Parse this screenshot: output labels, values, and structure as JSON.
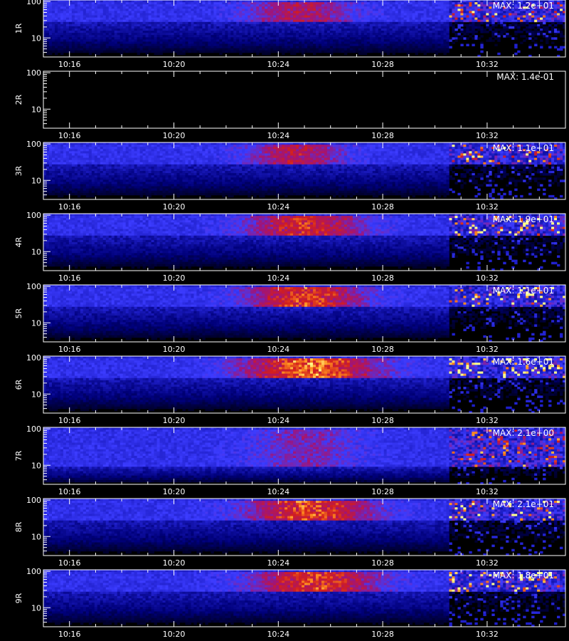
{
  "chart_data": {
    "type": "heatmap",
    "xlabel": "",
    "x_ticks": [
      "10:16",
      "10:20",
      "10:24",
      "10:28",
      "10:32"
    ],
    "x_range_min": [
      15,
      35
    ],
    "y_scale": "log",
    "y_ticks": [
      "100",
      "10"
    ],
    "y_range": [
      3,
      110
    ],
    "colors": {
      "background": "#000000",
      "low": "#00007a",
      "mid": "#3c3cff",
      "high_red": "#d21e1e",
      "high_orange": "#ff8c1e",
      "peak": "#ffff8c",
      "axes": "#ffffff"
    },
    "panels": [
      {
        "label": "1R",
        "max": "MAX: 1.2e+01",
        "level": 0.55,
        "burst_center_min": 24.8,
        "burst_width_min": 2.0,
        "band_top": 90,
        "band_bottom": 28,
        "empty": false
      },
      {
        "label": "2R",
        "max": "MAX: 1.4e-01",
        "level": 0.0,
        "burst_center_min": 24.8,
        "burst_width_min": 2.0,
        "band_top": 90,
        "band_bottom": 28,
        "empty": true
      },
      {
        "label": "3R",
        "max": "MAX: 1.1e+01",
        "level": 0.6,
        "burst_center_min": 24.6,
        "burst_width_min": 1.8,
        "band_top": 90,
        "band_bottom": 28,
        "empty": false
      },
      {
        "label": "4R",
        "max": "MAX: 1.9e+01",
        "level": 0.75,
        "burst_center_min": 25.0,
        "burst_width_min": 2.2,
        "band_top": 90,
        "band_bottom": 28,
        "empty": false
      },
      {
        "label": "5R",
        "max": "MAX: 1.1e+01",
        "level": 0.8,
        "burst_center_min": 25.0,
        "burst_width_min": 2.2,
        "band_top": 90,
        "band_bottom": 28,
        "empty": false
      },
      {
        "label": "6R",
        "max": "MAX: 1.6e+01",
        "level": 0.95,
        "burst_center_min": 25.2,
        "burst_width_min": 2.6,
        "band_top": 90,
        "band_bottom": 28,
        "empty": false
      },
      {
        "label": "7R",
        "max": "MAX: 2.1e+00",
        "level": 0.35,
        "burst_center_min": 25.0,
        "burst_width_min": 2.0,
        "band_top": 90,
        "band_bottom": 9,
        "empty": false
      },
      {
        "label": "8R",
        "max": "MAX: 2.1e+01",
        "level": 0.85,
        "burst_center_min": 25.2,
        "burst_width_min": 2.4,
        "band_top": 90,
        "band_bottom": 28,
        "empty": false
      },
      {
        "label": "9R",
        "max": "MAX: 1.8e+01",
        "level": 0.8,
        "burst_center_min": 25.4,
        "burst_width_min": 2.4,
        "band_top": 90,
        "band_bottom": 28,
        "empty": false
      }
    ],
    "data_gap_after_min": 30.5
  }
}
